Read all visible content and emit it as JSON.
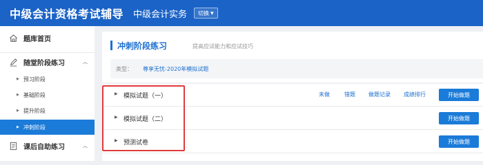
{
  "header": {
    "brand": "中级会计资格考试辅导",
    "subject": "中级会计实务",
    "switch_label": "切换"
  },
  "sidebar": {
    "items": [
      {
        "label": "题库首页",
        "icon": "home-icon"
      },
      {
        "label": "随堂阶段练习",
        "icon": "pen-icon"
      },
      {
        "label": "预习阶段"
      },
      {
        "label": "基础阶段"
      },
      {
        "label": "提升阶段"
      },
      {
        "label": "冲刺阶段",
        "active": true
      },
      {
        "label": "课后自助练习",
        "icon": "book-icon"
      }
    ]
  },
  "main": {
    "title": "冲刺阶段练习",
    "description": "提高应试能力和应试技巧",
    "type_label": "类型：",
    "type_value": "尊享无忧-2020年模拟试题",
    "rows": [
      {
        "name": "模拟试题（一）"
      },
      {
        "name": "模拟试题（二）"
      },
      {
        "name": "预测试卷"
      }
    ],
    "actions": {
      "undone": "未做",
      "wrong": "错题",
      "record": "做题记录",
      "ranking": "成绩排行"
    },
    "start_label": "开始做题"
  },
  "colors": {
    "header_bg": "#1b63c6",
    "accent": "#1b7bd8",
    "highlight": "#e03a3a"
  }
}
